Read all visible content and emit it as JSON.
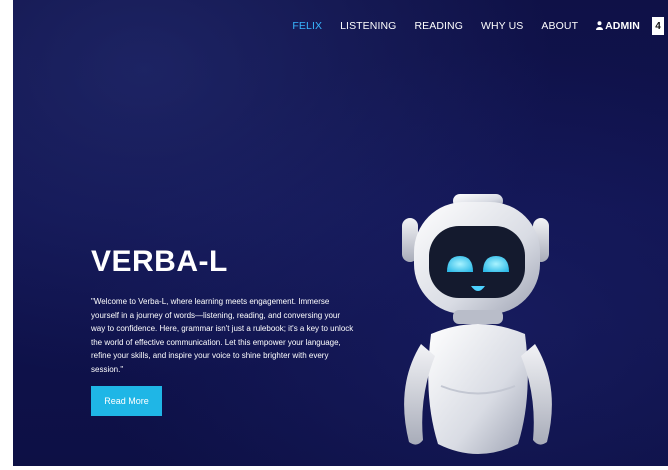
{
  "nav": {
    "items": [
      {
        "label": "FELIX",
        "active": true
      },
      {
        "label": "LISTENING",
        "active": false
      },
      {
        "label": "READING",
        "active": false
      },
      {
        "label": "WHY US",
        "active": false
      },
      {
        "label": "ABOUT",
        "active": false
      }
    ],
    "admin_label": "ADMIN",
    "admin_icon": "user-icon",
    "badge": "4"
  },
  "hero": {
    "title": "VERBA-L",
    "description": "\"Welcome to Verba-L, where learning meets engagement. Immerse yourself in a journey of words—listening, reading, and conversing your way to confidence. Here, grammar isn't just a rulebook; it's a key to unlock the world of effective communication. Let this empower your language, refine your skills, and inspire your voice to shine brighter with every session.\"",
    "button_label": "Read More",
    "image": "robot-mascot"
  },
  "colors": {
    "background": "#10134f",
    "accent": "#38b6ff",
    "button": "#1fb6e6",
    "text": "#ffffff"
  }
}
